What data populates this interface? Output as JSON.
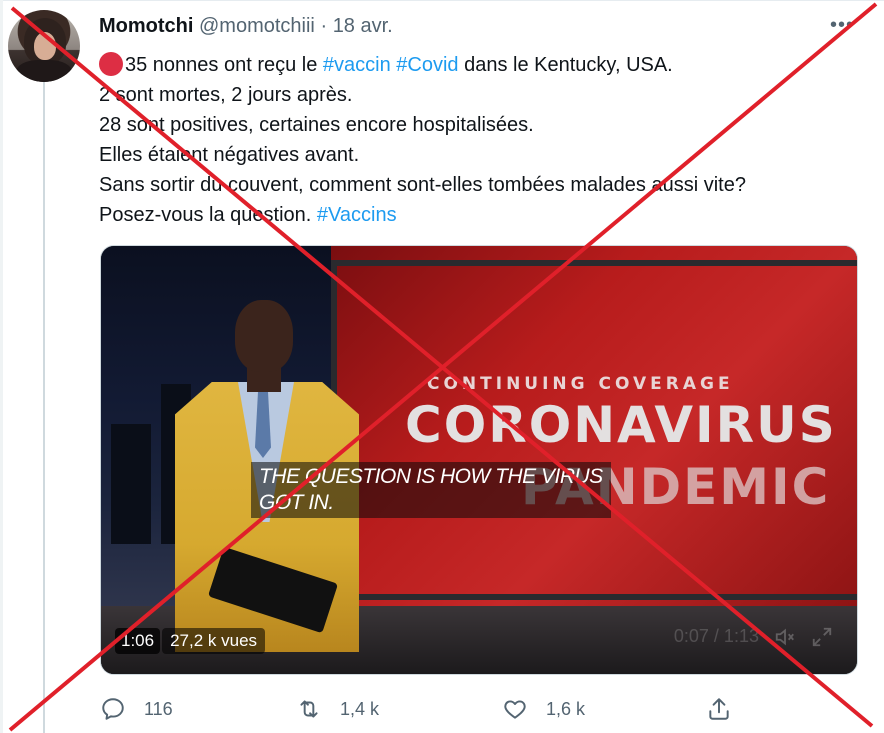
{
  "tweet": {
    "author_name": "Momotchi",
    "handle": "@momotchiii",
    "separator": "·",
    "date": "18 avr.",
    "more_label": "•••",
    "text_line1_pre": "35 nonnes ont reçu le ",
    "hashtag_vaccin": "#vaccin",
    "space": " ",
    "hashtag_covid": "#Covid",
    "text_line1_post": " dans le Kentucky, USA.",
    "text_line2": "2 sont mortes, 2 jours après.",
    "text_line3": "28 sont positives, certaines encore hospitalisées.",
    "text_line4": "Elles étaient négatives avant.",
    "text_line5": "Sans sortir du couvent, comment sont-elles tombées malades aussi vite?",
    "text_line6_pre": "Posez-vous la question. ",
    "hashtag_vaccins": "#Vaccins"
  },
  "video": {
    "banner_small": "CONTINUING COVERAGE",
    "banner_big": "CORONAVIRUS",
    "banner_big2": "PANDEMIC",
    "caption_line1": "THE QUESTION IS HOW THE VIRUS",
    "caption_line2": "GOT IN.",
    "duration": "1:06",
    "views": "27,2 k vues",
    "ghost_time": "0:07 / 1:13"
  },
  "actions": {
    "reply_count": "116",
    "retweet_count": "1,4 k",
    "like_count": "1,6 k"
  },
  "colors": {
    "hashtag": "#1d9bf0",
    "cross": "#e0202a",
    "muted": "#536471"
  },
  "icons": [
    "reply-icon",
    "retweet-icon",
    "like-icon",
    "share-icon",
    "more-icon",
    "volume-icon",
    "fullscreen-icon"
  ]
}
